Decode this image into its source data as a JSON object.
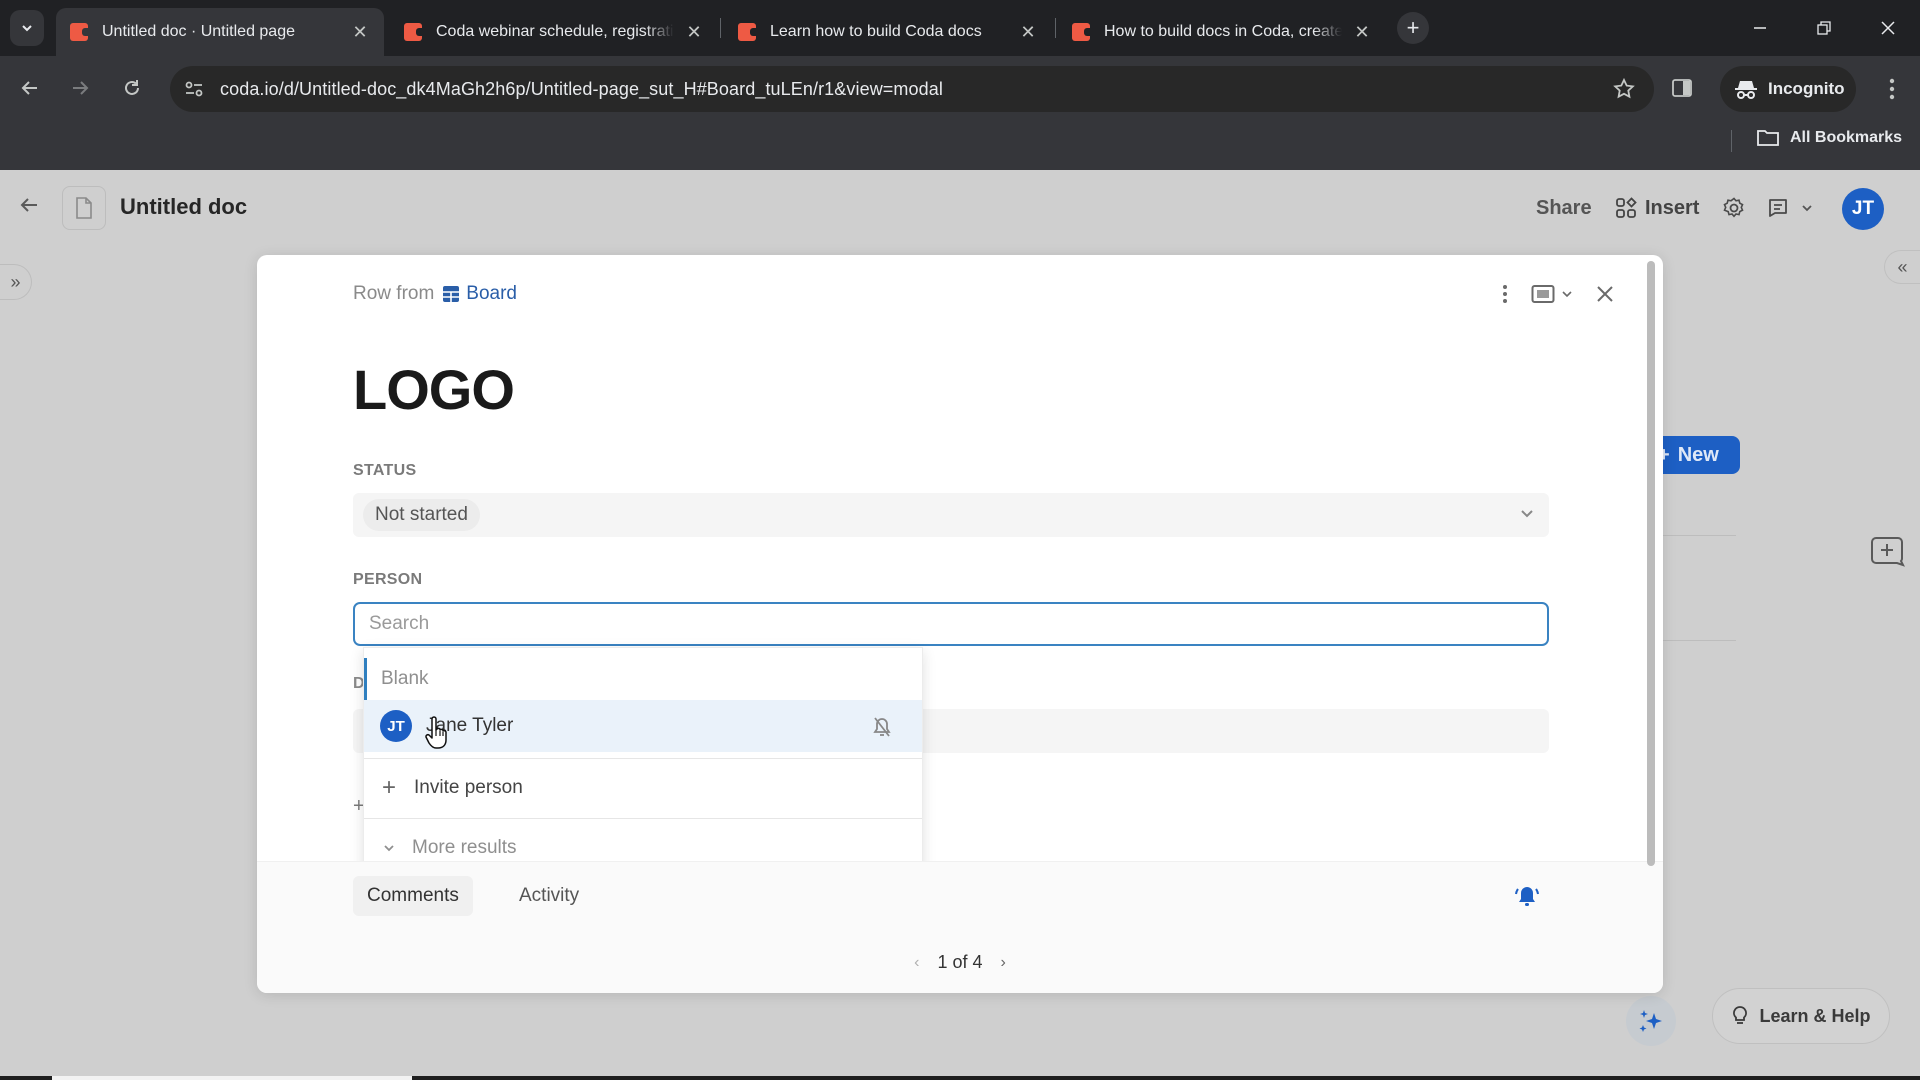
{
  "browser": {
    "tabs": [
      {
        "title": "Untitled doc · Untitled page",
        "active": true
      },
      {
        "title": "Coda webinar schedule, registration",
        "active": false
      },
      {
        "title": "Learn how to build Coda docs",
        "active": false
      },
      {
        "title": "How to build docs in Coda, create",
        "active": false
      }
    ],
    "url": "coda.io/d/Untitled-doc_dk4MaGh2h6p/Untitled-page_sut_H#Board_tuLEn/r1&view=modal",
    "incognito_label": "Incognito",
    "bookmarks_label": "All Bookmarks"
  },
  "doc": {
    "title": "Untitled doc",
    "share_label": "Share",
    "insert_label": "Insert",
    "user_initials": "JT",
    "new_button_label": "New",
    "learn_help_label": "Learn & Help"
  },
  "modal": {
    "row_from_label": "Row from",
    "table_name": "Board",
    "row_title": "LOGO",
    "status": {
      "label": "STATUS",
      "value": "Not started"
    },
    "person": {
      "label": "PERSON",
      "search_placeholder": "Search",
      "search_value": ""
    },
    "hidden_label_initial": "D",
    "dropdown": {
      "blank_label": "Blank",
      "people": [
        {
          "initials": "JT",
          "name": "Jane Tyler"
        }
      ],
      "invite_label": "Invite person",
      "more_label": "More results"
    },
    "footer": {
      "tabs": [
        "Comments",
        "Activity"
      ],
      "pager": "1 of 4"
    }
  },
  "colors": {
    "accent": "#1d5fc4",
    "focus_border": "#3a83c2",
    "coda_brand": "#ee5a44"
  }
}
